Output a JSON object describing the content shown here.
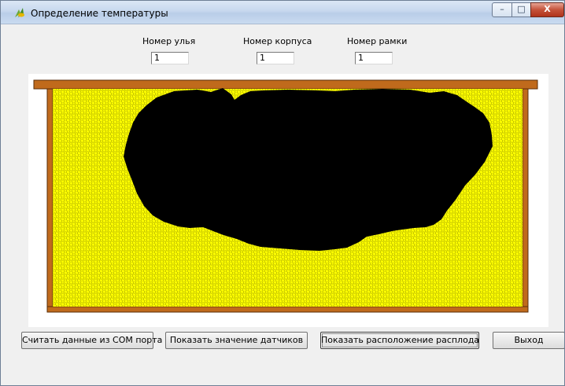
{
  "window": {
    "title": "Определение температуры",
    "controls": {
      "minimize": "–",
      "maximize": "□",
      "close": "X"
    }
  },
  "fields": [
    {
      "label": "Номер улья",
      "value": "1"
    },
    {
      "label": "Номер корпуса",
      "value": "1"
    },
    {
      "label": "Номер рамки",
      "value": "1"
    }
  ],
  "frame": {
    "cell_color": "#ffff00",
    "wood_color": "#c06a1c",
    "brood_color": "#000000"
  },
  "buttons": [
    {
      "label": "Считать данные из COM порта"
    },
    {
      "label": "Показать значение датчиков"
    },
    {
      "label": "Показать расположение расплода"
    },
    {
      "label": "Выход"
    }
  ]
}
